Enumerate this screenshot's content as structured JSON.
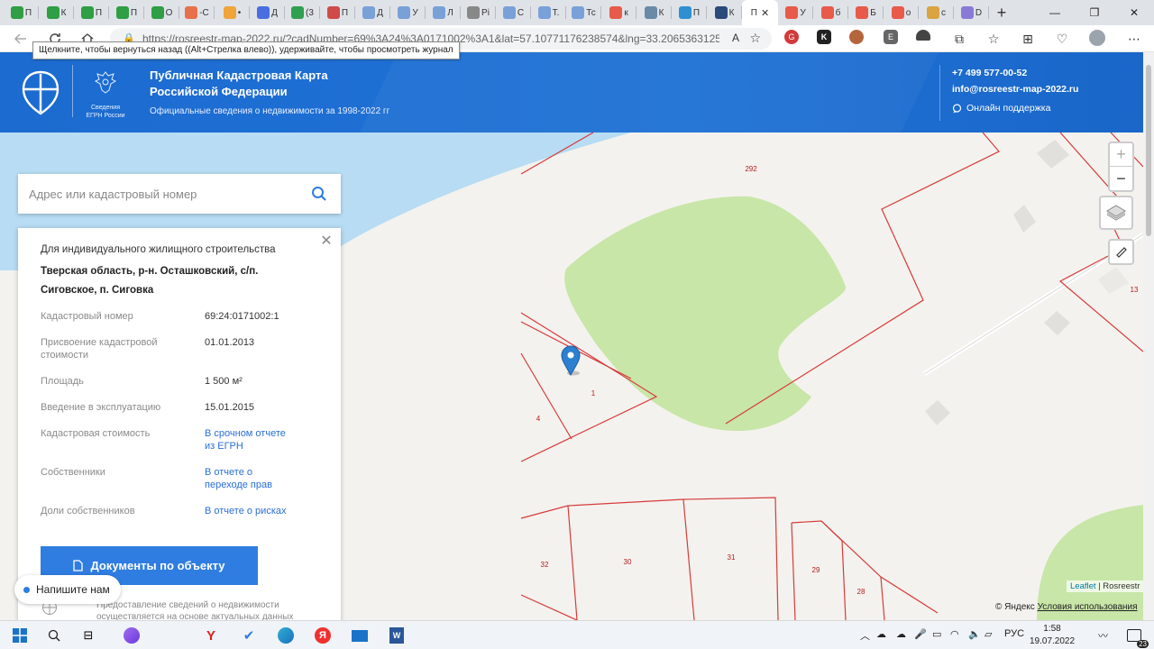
{
  "browser": {
    "tabs": [
      {
        "title": "П",
        "color": "#2f9e44"
      },
      {
        "title": "К",
        "color": "#2f9e44"
      },
      {
        "title": "П",
        "color": "#2f9e44"
      },
      {
        "title": "П",
        "color": "#2f9e44"
      },
      {
        "title": "О",
        "color": "#2f9e44"
      },
      {
        "title": "-С",
        "color": "#e8704a"
      },
      {
        "title": "•",
        "color": "#f0a43a"
      },
      {
        "title": "Д",
        "color": "#4a6ee0"
      },
      {
        "title": "(3",
        "color": "#2fa04f"
      },
      {
        "title": "П",
        "color": "#d04a4a"
      },
      {
        "title": "Д",
        "color": "#7aa0d8"
      },
      {
        "title": "У",
        "color": "#7aa0d8"
      },
      {
        "title": "Л",
        "color": "#7aa0d8"
      },
      {
        "title": "Рі",
        "color": "#888888"
      },
      {
        "title": "С",
        "color": "#7aa0d8"
      },
      {
        "title": "Т.",
        "color": "#7aa0d8"
      },
      {
        "title": "Тс",
        "color": "#7aa0d8"
      },
      {
        "title": "к",
        "color": "#e85a4a"
      },
      {
        "title": "К",
        "color": "#6a8aa8"
      },
      {
        "title": "П",
        "color": "#2f8fd0"
      },
      {
        "title": "К",
        "color": "#2a4a7a"
      }
    ],
    "active_tab": {
      "title": "П",
      "close": "✕"
    },
    "tabs_after": [
      {
        "title": "У",
        "color": "#e85a4a"
      },
      {
        "title": "б",
        "color": "#e85a4a"
      },
      {
        "title": "Б",
        "color": "#e85a4a"
      },
      {
        "title": "о",
        "color": "#e85a4a"
      },
      {
        "title": "с",
        "color": "#d9a441"
      },
      {
        "title": "D",
        "color": "#8a7ad8"
      }
    ],
    "new_tab": "+",
    "url": "https://rosreestr-map-2022.ru/?cadNumber=69%3A24%3A0171002%3A1&lat=57.10771176238574&lng=33.2065363125...",
    "tooltip": "Щелкните, чтобы вернуться назад ((Alt+Стрелка влево)), удерживайте, чтобы просмотреть журнал",
    "read_aloud": "A",
    "window_controls": [
      "—",
      "❐",
      "✕"
    ]
  },
  "header": {
    "emblem_label": "Сведения ЕГРН России",
    "title": "Публичная Кадастровая Карта Российской Федерации",
    "subtitle": "Официальные сведения о недвижимости за 1998-2022 гг",
    "phone": "+7 499 577-00-52",
    "email": "info@rosreestr-map-2022.ru",
    "support": "Онлайн поддержка"
  },
  "search": {
    "placeholder": "Адрес или кадастровый номер"
  },
  "info": {
    "purpose": "Для индивидуального жилищного строительства",
    "address": "Тверская область, р-н. Осташковский, с/п. Сиговское, п. Сиговка",
    "rows": [
      {
        "label": "Кадастровый номер",
        "value": "69:24:0171002:1"
      },
      {
        "label": "Присвоение кадастровой стоимости",
        "value": "01.01.2013"
      },
      {
        "label": "Площадь",
        "value": "1 500 м²"
      },
      {
        "label": "Введение в эксплуатацию",
        "value": "15.01.2015"
      },
      {
        "label": "Кадастровая стоимость",
        "value": "В срочном отчете из ЕГРН"
      },
      {
        "label": "Собственники",
        "value": "В отчете о переходе прав"
      },
      {
        "label": "Доли собственников",
        "value": "В отчете о рисках"
      }
    ],
    "docs_button": "Документы по объекту",
    "disclaimer": "Предоставление сведений о недвижимости осуществляется на основе актуальных данных"
  },
  "chat": {
    "label": "Напишите нам"
  },
  "map": {
    "parcel_labels": [
      "292",
      "1",
      "4",
      "13",
      "32",
      "30",
      "31",
      "29",
      "28"
    ],
    "zoom_in": "+",
    "zoom_out": "−",
    "leaflet": "Leaflet",
    "separator": "|",
    "rosreestr": "Rosreestr",
    "yandex": "© Яндекс",
    "terms": "Условия использования"
  },
  "taskbar": {
    "lang": "РУС",
    "time": "1:58",
    "date": "19.07.2022",
    "notif": "23"
  }
}
